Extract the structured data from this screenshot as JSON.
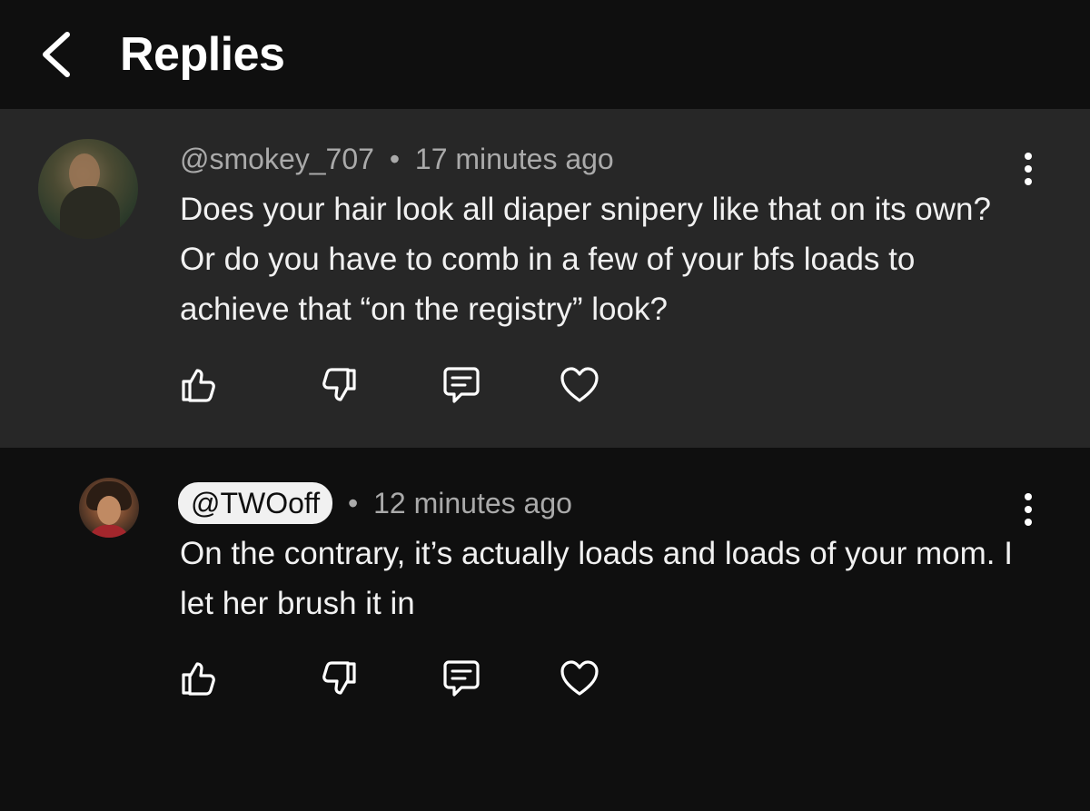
{
  "header": {
    "title": "Replies"
  },
  "comments": [
    {
      "handle": "@smokey_707",
      "separator": "•",
      "time": "17 minutes ago",
      "text": "Does your hair look all diaper snipery like that on its own? Or do you have to comb in a few of your bfs loads to achieve that “on the registry” look?",
      "highlighted": true
    },
    {
      "handle": "@TWOoff",
      "separator": "•",
      "time": "12 minutes ago",
      "text": "On the contrary, it’s actually loads and loads of your mom. I let her brush it in",
      "highlighted": false
    }
  ],
  "colors": {
    "background": "#0f0f0f",
    "highlighted_comment": "#272727",
    "primary_text": "#f1f1f1",
    "secondary_text": "#aaaaaa",
    "chip_background": "#f1f1f1"
  },
  "icons": {
    "back": "chevron-left-icon",
    "more": "vertical-ellipsis-icon",
    "like": "thumbs-up-icon",
    "dislike": "thumbs-down-icon",
    "reply": "comment-icon",
    "heart": "heart-icon"
  }
}
